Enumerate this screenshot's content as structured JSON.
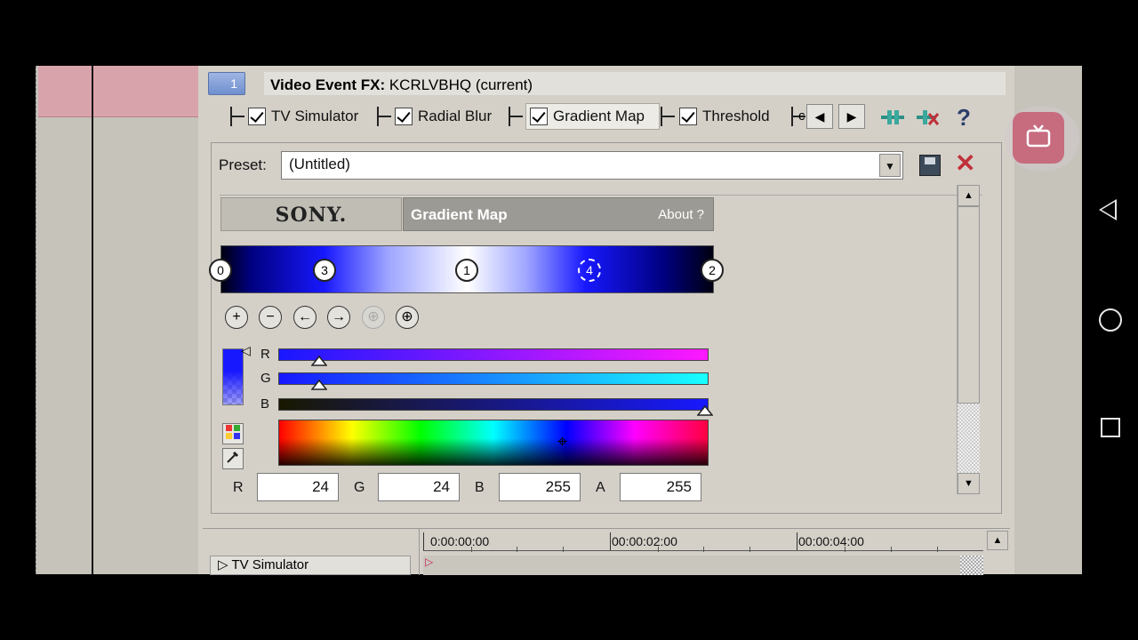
{
  "window": {
    "badge_number": "1",
    "title_label": "Video Event FX:",
    "title_value": " KCRLVBHQ (current)"
  },
  "chain": {
    "items": [
      {
        "label": "TV Simulator"
      },
      {
        "label": "Radial Blur"
      },
      {
        "label": "Gradient Map"
      },
      {
        "label": "Threshold"
      }
    ],
    "overflow_char": "c",
    "prev_glyph": "◀",
    "next_glyph": "▶",
    "help_glyph": "?"
  },
  "preset": {
    "label": "Preset:",
    "value": "(Untitled)",
    "dropdown_glyph": "▼",
    "close_glyph": "✕"
  },
  "plugin": {
    "brand": "SONY.",
    "name": "Gradient Map",
    "about": "About  ?",
    "stops": [
      "3",
      "1",
      "4"
    ],
    "stop_edge_left": "0",
    "stop_edge_right": "2",
    "toolbar_glyphs": [
      "+",
      "−",
      "←",
      "→",
      "⊕",
      "⊕"
    ],
    "sliders": {
      "r": "R",
      "g": "G",
      "b": "B"
    },
    "values": {
      "r_label": "R",
      "r": "24",
      "g_label": "G",
      "g": "24",
      "b_label": "B",
      "b": "255",
      "a_label": "A",
      "a": "255"
    },
    "scroll_up": "▲",
    "scroll_down": "▼"
  },
  "timeline": {
    "track_label": "TV Simulator",
    "times": [
      "0:00:00:00",
      "00:00:02:00",
      "00:00:04:00"
    ],
    "scroll_up": "▲"
  },
  "colors": {
    "accent_blue": "#1818ff",
    "close_red": "#c0303a",
    "cast_pink": "#c76b7e"
  }
}
